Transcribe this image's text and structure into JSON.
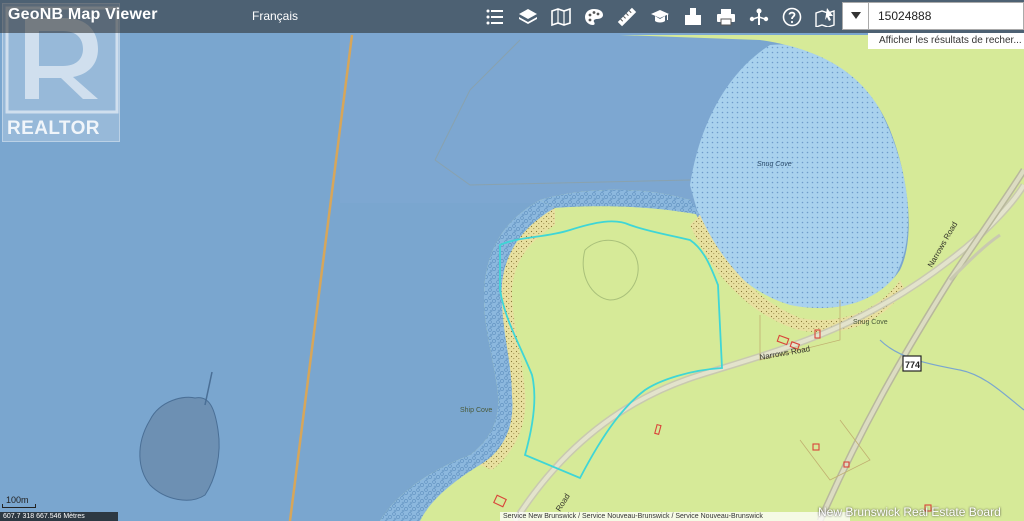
{
  "header": {
    "title_main": "GeoNB Map",
    "title_sub": "Viewer",
    "language_link": "Français"
  },
  "toolbar": {
    "tools": [
      {
        "name": "legend-list-icon"
      },
      {
        "name": "layers-icon"
      },
      {
        "name": "basemap-icon"
      },
      {
        "name": "palette-icon"
      },
      {
        "name": "measure-ruler-icon"
      },
      {
        "name": "education-cap-icon"
      },
      {
        "name": "bookmark-box-icon"
      },
      {
        "name": "print-icon"
      },
      {
        "name": "share-icon"
      },
      {
        "name": "help-icon"
      },
      {
        "name": "identify-map-icon"
      }
    ]
  },
  "search": {
    "value": "15024888",
    "hint": "Afficher les résultats de recher..."
  },
  "watermark": {
    "brand": "REALTOR"
  },
  "map": {
    "labels": {
      "narrows_road_1": "Narrows Road",
      "narrows_road_2": "Narrows Road",
      "snug_cove_1": "Snug Cove",
      "snug_cove_2": "Snug Cove",
      "ship_cove": "Ship Cove",
      "road": "Road",
      "route": "774"
    }
  },
  "footer": {
    "scale": "100m",
    "coords": "607.7 318 667.546 Mètres",
    "attribution": "Service New Brunswick / Service Nouveau-Brunswick / Service Nouveau-Brunswick",
    "board": "New Brunswick Real Estate Board"
  },
  "colors": {
    "water": "#7aa6cf",
    "land": "#d8ec9a",
    "parcel": "#3fd6d6",
    "toolbar": "#505050"
  }
}
